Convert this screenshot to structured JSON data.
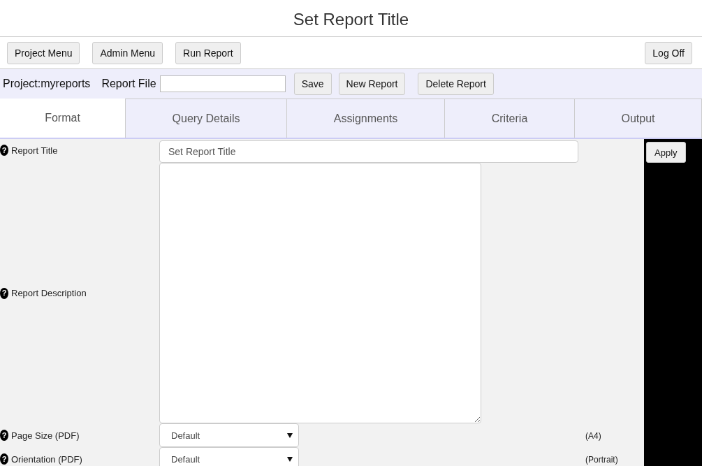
{
  "page_title": "Set Report Title",
  "nav_buttons": [
    "Project Menu",
    "Admin Menu",
    "Run Report"
  ],
  "logoff_button": "Log Off",
  "project_label": "Project:myreports",
  "report_file": {
    "label": "Report File"
  },
  "file_buttons": [
    "Save",
    "New Report",
    "Delete Report"
  ],
  "tabs": [
    {
      "label": "Format",
      "selected": true
    },
    {
      "label": "Query Details",
      "selected": false
    },
    {
      "label": "Assignments",
      "selected": false
    },
    {
      "label": "Criteria",
      "selected": false
    },
    {
      "label": "Output",
      "selected": false
    }
  ],
  "apply_button": "Apply",
  "fields": [
    {
      "kind": "text",
      "help": "?",
      "label": "Report Title",
      "value": "Set Report Title"
    },
    {
      "kind": "textarea",
      "help": "?",
      "label": "Report Description"
    },
    {
      "kind": "select",
      "help": "?",
      "label": "Page Size (PDF)",
      "value": "Default",
      "note": "(A4)"
    },
    {
      "kind": "select",
      "help": "?",
      "label": "Orientation (PDF)",
      "value": "Default",
      "note": "(Portrait)"
    }
  ]
}
